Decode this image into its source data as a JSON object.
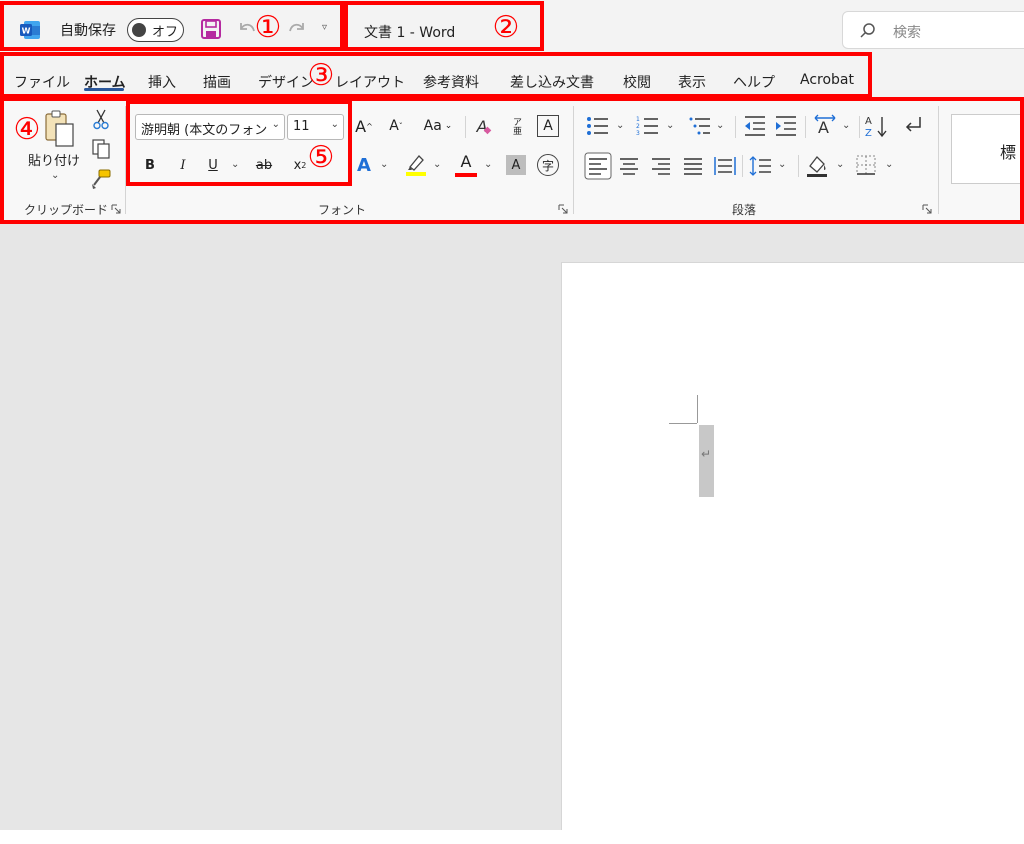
{
  "titlebar": {
    "app_icon": "word-logo-icon",
    "autosave_label": "自動保存",
    "autosave_state": "オフ",
    "doc_title": "文書 1  -  Word",
    "qat_more": "▿",
    "search_placeholder": "検索",
    "accent": "#2b579a",
    "save_icon_color": "#b52aa0"
  },
  "tabs": [
    {
      "label": "ファイル",
      "active": false
    },
    {
      "label": "ホーム",
      "active": true
    },
    {
      "label": "挿入",
      "active": false
    },
    {
      "label": "描画",
      "active": false
    },
    {
      "label": "デザイン",
      "active": false
    },
    {
      "label": "レイアウト",
      "active": false
    },
    {
      "label": "参考資料",
      "active": false
    },
    {
      "label": "差し込み文書",
      "active": false
    },
    {
      "label": "校閲",
      "active": false
    },
    {
      "label": "表示",
      "active": false
    },
    {
      "label": "ヘルプ",
      "active": false
    },
    {
      "label": "Acrobat",
      "active": false
    }
  ],
  "ribbon": {
    "clipboard": {
      "paste_label": "貼り付け",
      "group_label": "クリップボード"
    },
    "font": {
      "font_name": "游明朝 (本文のフォン",
      "font_size": "11",
      "grow": "A",
      "shrink": "A",
      "change_case": "Aa",
      "clear_format": "A",
      "phonetic": "ア亜",
      "char_border": "A",
      "bold": "B",
      "italic": "I",
      "underline": "U",
      "strike": "ab",
      "subscript": "x",
      "text_effect": "A",
      "font_color": "A",
      "char_shading": "A",
      "enclose": "字",
      "group_label": "フォント"
    },
    "paragraph": {
      "group_label": "段落"
    },
    "styles": {
      "preview_text": "標"
    }
  },
  "document": {
    "paragraph_mark": "↵"
  },
  "annotations": [
    "①",
    "②",
    "③",
    "④",
    "⑤"
  ],
  "colors": {
    "annotation": "#ff0000",
    "highlight": "#ffff00",
    "font_color_bar": "#ff0000",
    "text_effect": "#1f6fd6"
  }
}
